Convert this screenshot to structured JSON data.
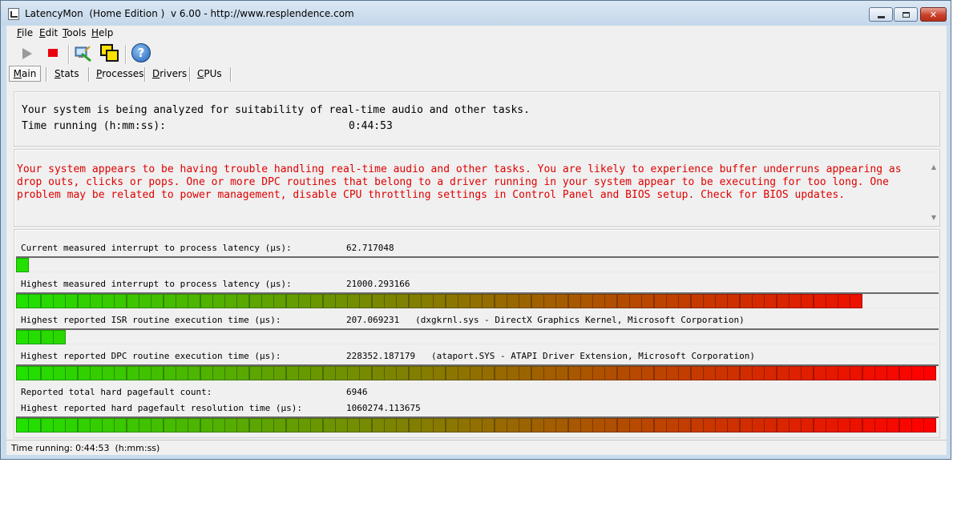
{
  "window": {
    "title": "LatencyMon  (Home Edition )  v 6.00 - http://www.resplendence.com"
  },
  "menu": {
    "items": [
      {
        "key": "F",
        "rest": "ile"
      },
      {
        "key": "E",
        "rest": "dit"
      },
      {
        "key": "T",
        "rest": "ools"
      },
      {
        "key": "H",
        "rest": "elp"
      }
    ]
  },
  "toolbar": {
    "icons": [
      "play-icon",
      "stop-icon",
      "drivers-icon",
      "windows-icon",
      "help-icon"
    ]
  },
  "tabs": {
    "items": [
      {
        "key": "M",
        "rest": "ain"
      },
      {
        "key": "S",
        "rest": "tats"
      },
      {
        "key": "P",
        "rest": "rocesses"
      },
      {
        "key": "D",
        "rest": "rivers"
      },
      {
        "key": "C",
        "rest": "PUs"
      }
    ]
  },
  "summary": {
    "line1": "Your system is being analyzed for suitability of real-time audio and other tasks.",
    "time_label": "Time running (h:mm:ss):",
    "time_value": "0:44:53"
  },
  "warning": {
    "text": "Your system appears to be having trouble handling real-time audio and other tasks. You are likely to experience buffer underruns appearing as drop outs, clicks or pops. One or more DPC routines that belong to a driver running in your system appear to be executing for too long. One problem may be related to power management, disable CPU throttling settings in Control Panel and BIOS setup. Check for BIOS updates."
  },
  "metrics": {
    "current_latency": {
      "label": "Current measured interrupt to process latency (µs):",
      "value": "62.717048",
      "bar_fraction": 0.013
    },
    "highest_latency": {
      "label": "Highest measured interrupt to process latency (µs):",
      "value": "21000.293166",
      "bar_fraction": 0.917
    },
    "highest_isr": {
      "label": "Highest reported ISR routine execution time (µs):",
      "value": "207.069231   (dxgkrnl.sys - DirectX Graphics Kernel, Microsoft Corporation)",
      "bar_fraction": 0.054
    },
    "highest_dpc": {
      "label": "Highest reported DPC routine execution time (µs):",
      "value": "228352.187179   (ataport.SYS - ATAPI Driver Extension, Microsoft Corporation)",
      "bar_fraction": 1.0
    },
    "pagefault_count": {
      "label": "Reported total hard pagefault count:",
      "value": "6946"
    },
    "pagefault_resolution": {
      "label": "Highest reported hard pagefault resolution time (µs):",
      "value": "1060274.113675",
      "bar_fraction": 1.0
    }
  },
  "status": {
    "text": "Time running: 0:44:53  (h:mm:ss)"
  },
  "colors": {
    "bar_start": "#22e000",
    "bar_end": "#ff0000",
    "warning_text": "#e00000"
  }
}
